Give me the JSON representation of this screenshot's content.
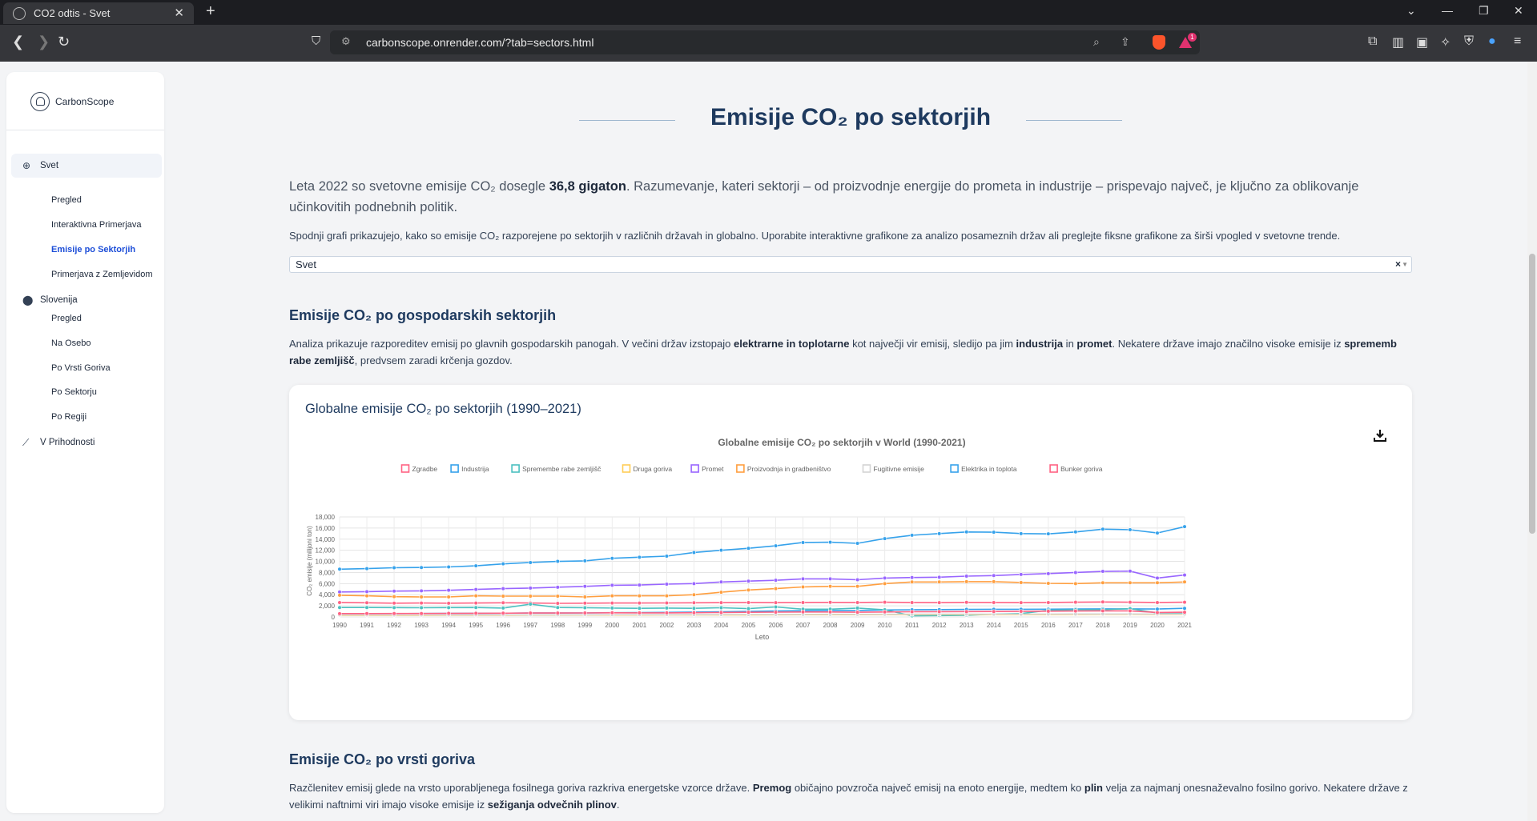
{
  "browser": {
    "tab_title": "CO2 odtis - Svet",
    "url": "carbonscope.onrender.com/?tab=sectors.html",
    "rewards_badge": "1"
  },
  "sidebar": {
    "brand": "CarbonScope",
    "sections": [
      {
        "label": "Svet",
        "icon": "globe-icon",
        "items": [
          "Pregled",
          "Interaktivna Primerjava",
          "Emisije po Sektorjih",
          "Primerjava z Zemljevidom"
        ]
      },
      {
        "label": "Slovenija",
        "icon": "location-pin-icon",
        "items": [
          "Pregled",
          "Na Osebo",
          "Po Vrsti Goriva",
          "Po Sektorju",
          "Po Regiji"
        ]
      },
      {
        "label": "V Prihodnosti",
        "icon": "line-chart-icon",
        "items": []
      }
    ],
    "current": "Emisije po Sektorjih"
  },
  "main": {
    "title": "Emisije CO₂ po sektorjih",
    "lead_pre": "Leta 2022 so svetovne emisije CO₂ dosegle ",
    "lead_bold": "36,8 gigaton",
    "lead_post": ". Razumevanje, kateri sektorji – od proizvodnje energije do prometa in industrije – prispevajo največ, je ključno za oblikovanje učinkovitih podnebnih politik.",
    "sub": "Spodnji grafi prikazujejo, kako so emisije CO₂ razporejene po sektorjih v različnih državah in globalno. Uporabite interaktivne grafikone za analizo posameznih držav ali preglejte fiksne grafikone za širši vpogled v svetovne trende.",
    "select_value": "Svet",
    "select_clear": "×",
    "section1_title": "Emisije CO₂ po gospodarskih sektorjih",
    "section1_p1": "Analiza prikazuje razporeditev emisij po glavnih gospodarskih panogah. V večini držav izstopajo ",
    "section1_b1": "elektrarne in toplotarne",
    "section1_p2": " kot največji vir emisij, sledijo pa jim ",
    "section1_b2": "industrija",
    "section1_p3": " in ",
    "section1_b3": "promet",
    "section1_p4": ". Nekatere države imajo značilno visoke emisije iz ",
    "section1_b4": "sprememb rabe zemljišč",
    "section1_p5": ", predvsem zaradi krčenja gozdov.",
    "card_title": "Globalne emisije CO₂ po sektorjih (1990–2021)",
    "section2_title": "Emisije CO₂ po vrsti goriva",
    "section2_p1": "Razčlenitev emisij glede na vrsto uporabljenega fosilnega goriva razkriva energetske vzorce države. ",
    "section2_b1": "Premog",
    "section2_p2": " običajno povzroča največ emisij na enoto energije, medtem ko ",
    "section2_b2": "plin",
    "section2_p3": " velja za najmanj onesnaževalno fosilno gorivo. Nekatere države z velikimi naftnimi viri imajo visoke emisije iz ",
    "section2_b3": "sežiganja odvečnih plinov",
    "section2_p4": "."
  },
  "chart_data": {
    "type": "line",
    "title": "Globalne emisije CO₂ po sektorjih v World (1990-2021)",
    "xlabel": "Leto",
    "ylabel": "CO₂ emisije (milijoni ton)",
    "ylim": [
      0,
      18000
    ],
    "yticks": [
      "0",
      "2,000",
      "4,000",
      "6,000",
      "8,000",
      "10,000",
      "12,000",
      "14,000",
      "16,000",
      "18,000"
    ],
    "x": [
      1990,
      1991,
      1992,
      1993,
      1994,
      1995,
      1996,
      1997,
      1998,
      1999,
      2000,
      2001,
      2002,
      2003,
      2004,
      2005,
      2006,
      2007,
      2008,
      2009,
      2010,
      2011,
      2012,
      2013,
      2014,
      2015,
      2016,
      2017,
      2018,
      2019,
      2020,
      2021
    ],
    "grid": true,
    "legend": "top",
    "series": [
      {
        "name": "Zgradbe",
        "color": "#ff6384",
        "values": [
          2600,
          2550,
          2480,
          2500,
          2470,
          2500,
          2550,
          2500,
          2450,
          2480,
          2500,
          2500,
          2520,
          2550,
          2580,
          2600,
          2580,
          2600,
          2620,
          2600,
          2650,
          2600,
          2580,
          2620,
          2600,
          2580,
          2600,
          2650,
          2700,
          2650,
          2600,
          2650
        ]
      },
      {
        "name": "Industrija",
        "color": "#36a2eb",
        "values": [
          600,
          600,
          610,
          620,
          640,
          660,
          680,
          700,
          700,
          720,
          760,
          780,
          820,
          880,
          940,
          1000,
          1060,
          1120,
          1160,
          1160,
          1260,
          1300,
          1320,
          1360,
          1380,
          1380,
          1400,
          1420,
          1460,
          1460,
          1420,
          1550
        ]
      },
      {
        "name": "Spremembe rabe zemljišč",
        "color": "#4bc0c0",
        "values": [
          1700,
          1700,
          1680,
          1650,
          1680,
          1700,
          1600,
          2300,
          1700,
          1650,
          1600,
          1550,
          1600,
          1550,
          1650,
          1500,
          1800,
          1400,
          1400,
          1600,
          1300,
          200,
          250,
          300,
          500,
          600,
          1200,
          1300,
          1300,
          1500,
          700,
          750
        ]
      },
      {
        "name": "Druga goriva",
        "color": "#ffcd56",
        "values": [
          300,
          300,
          300,
          300,
          310,
          320,
          320,
          330,
          330,
          340,
          350,
          350,
          360,
          360,
          370,
          380,
          390,
          400,
          400,
          400,
          420,
          420,
          430,
          440,
          440,
          440,
          450,
          460,
          470,
          470,
          460,
          480
        ]
      },
      {
        "name": "Promet",
        "color": "#9966ff",
        "values": [
          4500,
          4550,
          4650,
          4700,
          4800,
          4950,
          5100,
          5200,
          5350,
          5500,
          5700,
          5750,
          5900,
          6000,
          6300,
          6450,
          6600,
          6850,
          6850,
          6700,
          7000,
          7100,
          7150,
          7350,
          7450,
          7650,
          7800,
          8000,
          8200,
          8250,
          7000,
          7550
        ]
      },
      {
        "name": "Proizvodnja in gradbeništvo",
        "color": "#ff9f40",
        "values": [
          3900,
          3800,
          3650,
          3600,
          3600,
          3800,
          3750,
          3750,
          3750,
          3600,
          3800,
          3800,
          3800,
          4000,
          4450,
          4850,
          5100,
          5400,
          5500,
          5500,
          6000,
          6300,
          6300,
          6350,
          6350,
          6200,
          6050,
          6000,
          6150,
          6150,
          6150,
          6300
        ]
      },
      {
        "name": "Fugitivne emisije",
        "color": "#d4d4d4",
        "values": [
          380,
          370,
          360,
          360,
          360,
          370,
          380,
          380,
          380,
          390,
          400,
          400,
          410,
          420,
          430,
          440,
          450,
          460,
          470,
          460,
          480,
          490,
          500,
          500,
          510,
          510,
          520,
          530,
          540,
          540,
          520,
          530
        ]
      },
      {
        "name": "Elektrika in toplota",
        "color": "#36a2eb",
        "values": [
          8600,
          8700,
          8850,
          8900,
          9000,
          9200,
          9550,
          9800,
          10000,
          10100,
          10550,
          10750,
          10950,
          11600,
          12000,
          12350,
          12800,
          13400,
          13450,
          13250,
          14100,
          14700,
          15000,
          15300,
          15250,
          15000,
          14950,
          15300,
          15800,
          15700,
          15100,
          16250
        ]
      },
      {
        "name": "Bunker goriva",
        "color": "#ff6384",
        "values": [
          600,
          610,
          620,
          620,
          640,
          660,
          680,
          700,
          710,
          720,
          750,
          740,
          740,
          760,
          800,
          840,
          870,
          900,
          900,
          850,
          900,
          930,
          950,
          960,
          980,
          1000,
          1030,
          1060,
          1100,
          1100,
          800,
          850
        ]
      }
    ]
  }
}
